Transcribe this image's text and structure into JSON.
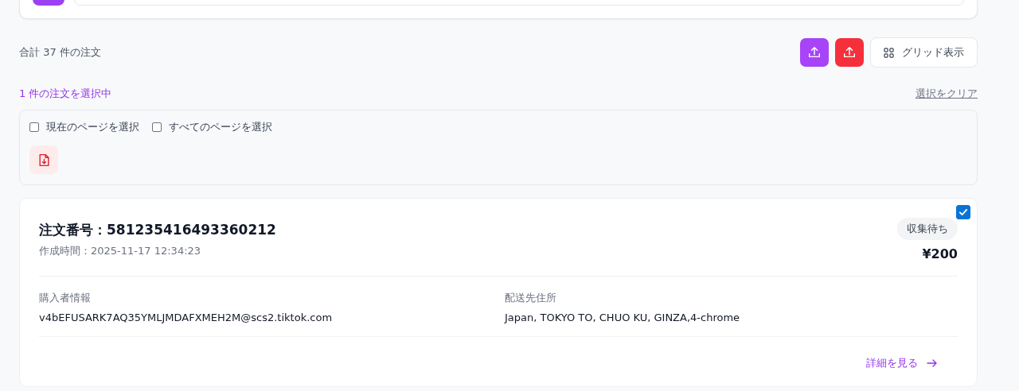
{
  "summary": {
    "total": "合計 37 件の注文",
    "view_button": "グリッド表示"
  },
  "selection": {
    "count": "1 件の注文を選択中",
    "clear": "選択をクリア",
    "options": [
      {
        "label": "現在のページを選択",
        "checked": false
      },
      {
        "label": "すべてのページを選択",
        "checked": false
      }
    ]
  },
  "orders": [
    {
      "number": "注文番号：581235416493360212",
      "created": "作成時間：2025-11-17 12:34:23",
      "checked": true,
      "status": "収集待ち",
      "amount": "¥200",
      "fields": [
        {
          "label": "購入者情報",
          "value": "v4bEFUSARK7AQ35YMLJMDAFXMEH2M@scs2.tiktok.com"
        },
        {
          "label": "配送先住所",
          "value": "Japan, TOKYO TO, CHUO KU, GINZA,4-chrome"
        }
      ],
      "link": "詳細を見る"
    }
  ]
}
